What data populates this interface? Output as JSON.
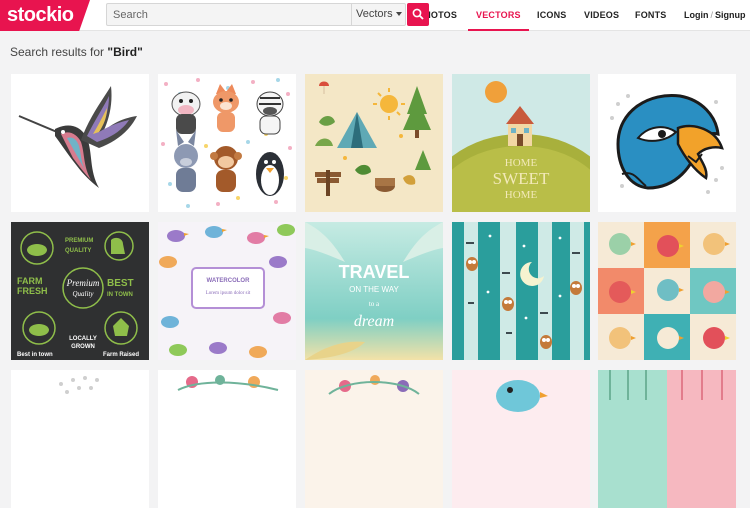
{
  "brand": {
    "logo_text": "stockio",
    "accent": "#e8144f"
  },
  "search": {
    "placeholder": "Search",
    "type_selected": "Vectors"
  },
  "nav": [
    {
      "label": "PHOTOS",
      "visible_text": "PHOTOS",
      "active": false
    },
    {
      "label": "VECTORS",
      "active": true
    },
    {
      "label": "ICONS",
      "active": false
    },
    {
      "label": "VIDEOS",
      "active": false
    },
    {
      "label": "FONTS",
      "active": false
    }
  ],
  "account": {
    "login": "Login",
    "separator": "/",
    "signup": "Signup"
  },
  "results": {
    "prefix": "Search results for",
    "query": "\"Bird\""
  },
  "thumbnails": [
    {
      "subject": "hummingbird"
    },
    {
      "subject": "cartoon animals"
    },
    {
      "subject": "camping elements"
    },
    {
      "subject": "home sweet home",
      "text": [
        "HOME",
        "SWEET",
        "HOME"
      ]
    },
    {
      "subject": "eagle mascot"
    },
    {
      "subject": "farm labels",
      "text": [
        "PREMIUM",
        "QUALITY",
        "FARM",
        "FRESH",
        "Premium",
        "Quality",
        "BEST",
        "IN TOWN",
        "LOCALLY",
        "GROWN",
        "Best in town",
        "Farm Raised"
      ]
    },
    {
      "subject": "birds pattern",
      "text": [
        "WATERCOLOR",
        "Lorem ipsum dolor sit"
      ]
    },
    {
      "subject": "travel poster",
      "text": [
        "TRAVEL",
        "ON THE WAY",
        "to a",
        "dream"
      ]
    },
    {
      "subject": "owls in birch forest"
    },
    {
      "subject": "birds squares"
    },
    {
      "subject": "halftone"
    },
    {
      "subject": "floral"
    },
    {
      "subject": "floral wreath"
    },
    {
      "subject": "cartoon bird"
    },
    {
      "subject": "pattern"
    }
  ]
}
